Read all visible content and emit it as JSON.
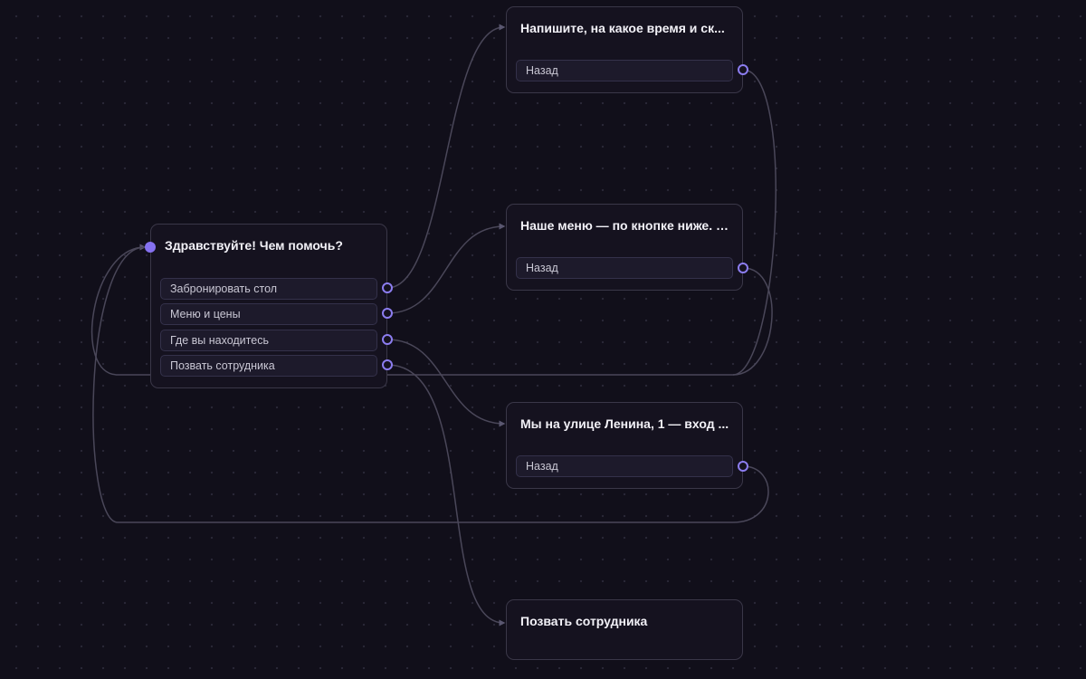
{
  "colors": {
    "background": "#110f1a",
    "edge": "#4a4759",
    "port": "#8c7df0",
    "accent": "#8571f0"
  },
  "nodes": {
    "start": {
      "title": "Здравствуйте! Чем помочь?",
      "options": [
        "Забронировать стол",
        "Меню и цены",
        "Где вы находитесь",
        "Позвать сотрудника"
      ]
    },
    "booking": {
      "title": "Напишите, на какое время и ск...",
      "back_label": "Назад"
    },
    "menu": {
      "title": "Наше меню — по кнопке ниже. Е...",
      "back_label": "Назад"
    },
    "location": {
      "title": "Мы на улице Ленина, 1 — вход ...",
      "back_label": "Назад"
    },
    "staff": {
      "title": "Позвать сотрудника"
    }
  }
}
